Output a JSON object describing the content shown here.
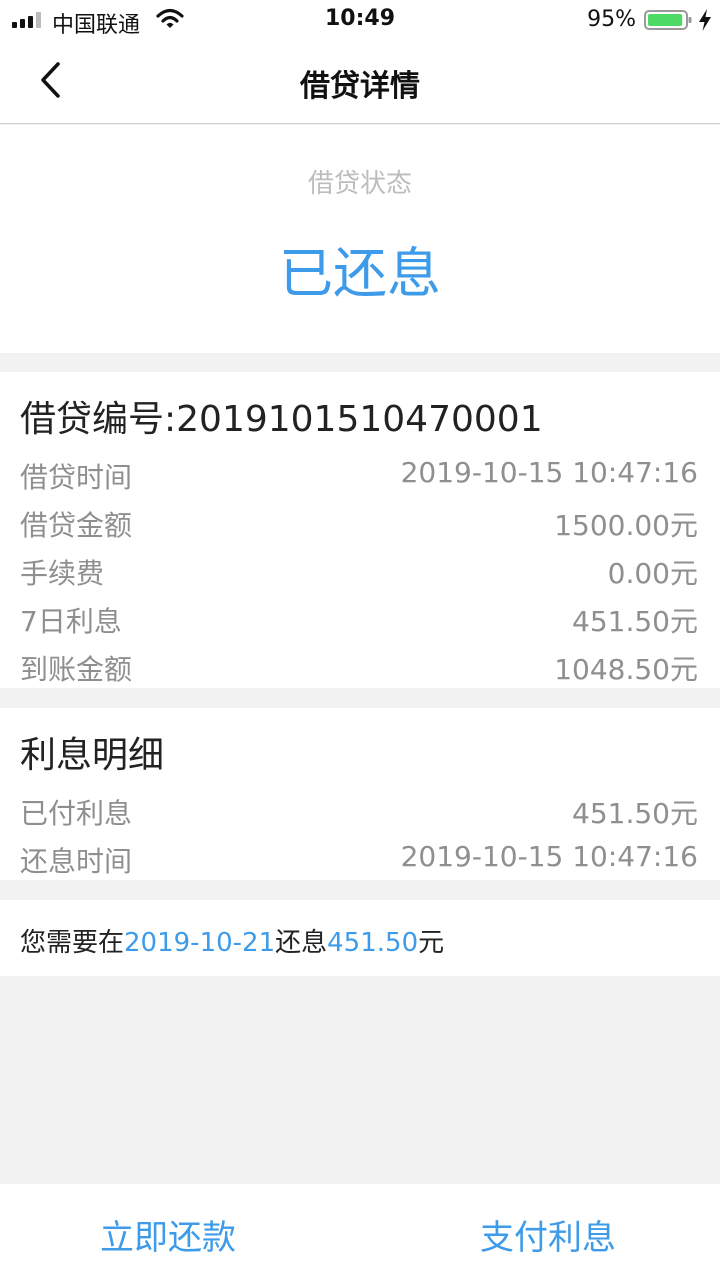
{
  "status_bar": {
    "carrier": "中国联通",
    "time": "10:49",
    "battery_percent": "95%",
    "battery_level": 0.95,
    "signal_bars": 4,
    "icons": [
      "signal-icon",
      "wifi-icon",
      "battery-icon",
      "charging-bolt-icon"
    ]
  },
  "nav": {
    "back_icon": "chevron-left-icon",
    "title": "借贷详情"
  },
  "status_card": {
    "label": "借贷状态",
    "value": "已还息"
  },
  "loan": {
    "title": "借贷编号:2019101510470001",
    "rows": [
      {
        "label": "借贷时间",
        "value": "2019-10-15 10:47:16"
      },
      {
        "label": "借贷金额",
        "value": "1500.00元"
      },
      {
        "label": "手续费",
        "value": "0.00元"
      },
      {
        "label": "7日利息",
        "value": "451.50元"
      },
      {
        "label": "到账金额",
        "value": "1048.50元"
      }
    ]
  },
  "interest": {
    "title": "利息明细",
    "rows": [
      {
        "label": "已付利息",
        "value": "451.50元"
      },
      {
        "label": "还息时间",
        "value": "2019-10-15 10:47:16"
      }
    ]
  },
  "notice": {
    "prefix": "您需要在",
    "date": "2019-10-21",
    "middle": "还息",
    "amount": "451.50",
    "suffix": "元"
  },
  "actions": {
    "repay_now": "立即还款",
    "pay_interest": "支付利息"
  },
  "colors": {
    "accent": "#3d9be9",
    "background": "#f2f2f2",
    "muted_text": "#8f8f8f",
    "battery_green": "#4cd964"
  }
}
